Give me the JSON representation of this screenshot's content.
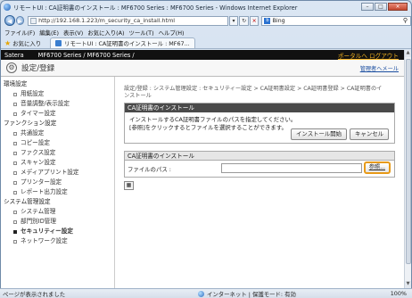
{
  "window": {
    "title": "リモートUI : CA証明書のインストール : MF6700 Series : MF6700 Series - Windows Internet Explorer",
    "minimize": "–",
    "maximize": "□",
    "close": "×"
  },
  "address": {
    "url": "http://192.168.1.223/m_security_ca_install.html",
    "search_placeholder": "Bing",
    "back": "◀",
    "forward": "▶",
    "refresh": "↻",
    "stop": "×",
    "dropdown": "▾",
    "search_icon": "⚲"
  },
  "menu": [
    "ファイル(F)",
    "編集(E)",
    "表示(V)",
    "お気に入り(A)",
    "ツール(T)",
    "ヘルプ(H)"
  ],
  "favorites": {
    "label": "お気に入り",
    "tab_title": "リモートUI : CA証明書のインストール : MF67..."
  },
  "topbar": {
    "brand": "Satera",
    "model": "MF6700 Series / MF6700 Series /",
    "links": "ポータルへ  ログアウト"
  },
  "header": {
    "title": "設定/登録",
    "admin_link": "管理者へメール"
  },
  "sidebar": {
    "sections": [
      {
        "heading": "環境設定",
        "items": [
          "用紙設定",
          "音量調整/表示設定",
          "タイマー設定"
        ]
      },
      {
        "heading": "ファンクション設定",
        "items": [
          "共通設定",
          "コピー設定",
          "ファクス設定",
          "スキャン設定",
          "メディアプリント設定",
          "プリンター設定",
          "レポート出力設定"
        ]
      },
      {
        "heading": "システム管理設定",
        "items": [
          "システム管理",
          "部門別ID管理",
          "セキュリティー設定",
          "ネットワーク設定"
        ]
      }
    ],
    "active": "セキュリティー設定"
  },
  "breadcrumb": {
    "line1": "設定/登録 : システム管理設定 : セキュリティー設定 > CA証明書設定 > CA証明書登録 > CA証明書のイ",
    "line2": "ンストール"
  },
  "install_box": {
    "title": "CA証明書のインストール",
    "desc1": "インストールするCA証明書ファイルのパスを指定してください。",
    "desc2": "[参照]をクリックするとファイルを選択することができます。",
    "start_button": "インストール開始",
    "cancel_button": "キャンセル"
  },
  "file_box": {
    "title": "CA証明書のインストール",
    "path_label": "ファイルのパス :",
    "browse_button": "参照..."
  },
  "status": {
    "text": "ページが表示されました",
    "zone": "インターネット | 保護モード: 有効",
    "zoom": "100%"
  },
  "colors": {
    "accent_highlight": "#e79a18",
    "topbar_bg": "#111111",
    "section_header_bg": "#4a4a4a"
  }
}
